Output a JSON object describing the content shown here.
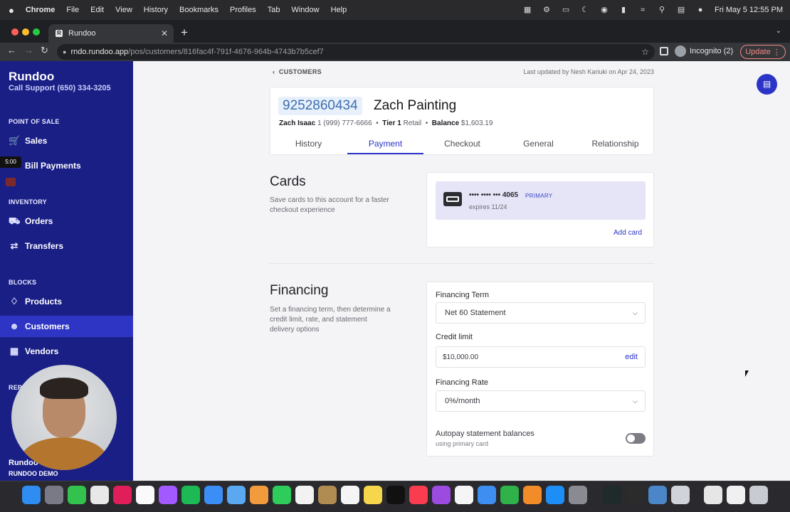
{
  "menubar": {
    "apple": "",
    "items": [
      "Chrome",
      "File",
      "Edit",
      "View",
      "History",
      "Bookmarks",
      "Profiles",
      "Tab",
      "Window",
      "Help"
    ],
    "clock": "Fri May 5  12:55 PM"
  },
  "browser": {
    "tab_title": "Rundoo",
    "url_host": "rndo.rundoo.app",
    "url_path": "/pos/customers/816fac4f-791f-4676-964b-4743b7b5cef7",
    "profile": "Incognito (2)",
    "update_label": "Update"
  },
  "sidebar": {
    "brand": "Rundoo",
    "support": "Call Support (650) 334-3205",
    "timer": "5:00",
    "sections": {
      "pos": "POINT OF SALE",
      "inventory": "INVENTORY",
      "blocks": "BLOCKS",
      "reports": "REPO"
    },
    "items": {
      "sales": "Sales",
      "bill_payments": "Bill Payments",
      "orders": "Orders",
      "transfers": "Transfers",
      "products": "Products",
      "customers": "Customers",
      "vendors": "Vendors"
    },
    "account_name": "Rundoo",
    "account_org": "RUNDOO DEMO"
  },
  "header": {
    "back": "CUSTOMERS",
    "last_updated": "Last updated by Nesh Kariuki on Apr 24, 2023",
    "phone": "9252860434",
    "name": "Zach Painting",
    "contact_name": "Zach Isaac",
    "contact_phone": "1 (999) 777-6666",
    "tier_label": "Tier 1",
    "tier_value": "Retail",
    "balance_label": "Balance",
    "balance_value": "$1,603.19"
  },
  "tabs": [
    "History",
    "Payment",
    "Checkout",
    "General",
    "Relationship"
  ],
  "active_tab": "Payment",
  "cards": {
    "title": "Cards",
    "description": "Save cards to this account for a faster checkout experience",
    "card_number": "•••• •••• ••• 4065",
    "card_badge": "PRIMARY",
    "card_expiry": "expires 11/24",
    "add_label": "Add card"
  },
  "financing": {
    "title": "Financing",
    "description": "Set a financing term, then determine a credit limit, rate, and statement delivery options",
    "term_label": "Financing Term",
    "term_value": "Net 60 Statement",
    "limit_label": "Credit limit",
    "limit_value": "$10,000.00",
    "limit_edit": "edit",
    "rate_label": "Financing Rate",
    "rate_value": "0%/month",
    "autopay_label": "Autopay statement balances",
    "autopay_sub": "using primary card",
    "autopay_on": false
  },
  "colors": {
    "sidebar": "#1a1f86",
    "accent": "#2b34c7",
    "active_nav": "#2e35c4"
  }
}
